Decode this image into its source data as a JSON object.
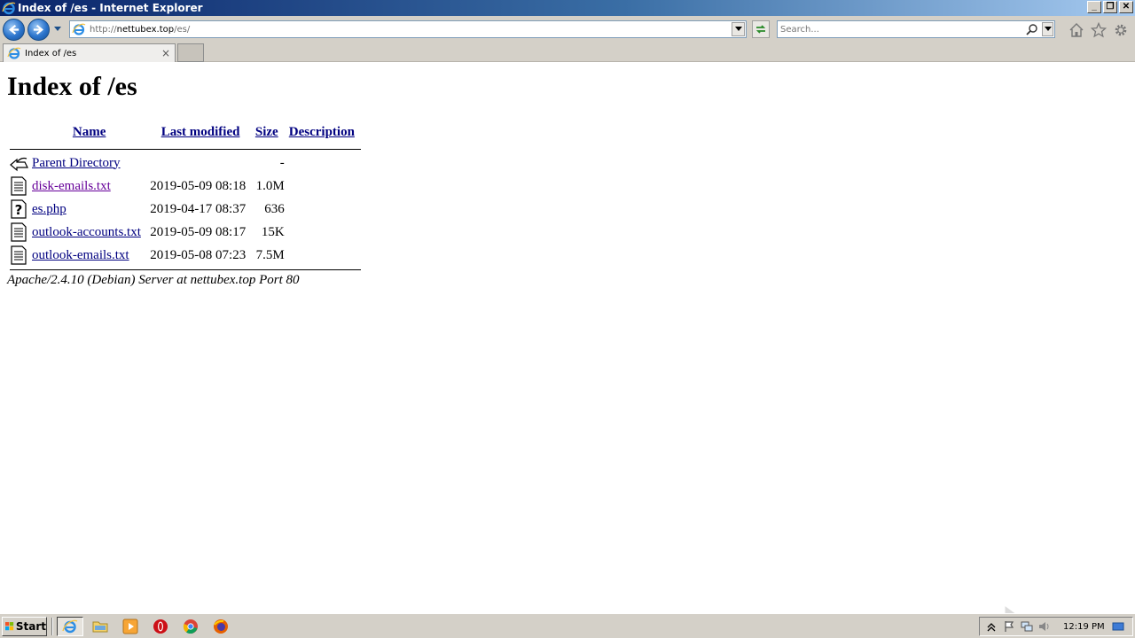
{
  "window": {
    "title": "Index of /es - Internet Explorer",
    "minimize_label": "_",
    "restore_label": "❐",
    "close_label": "✕"
  },
  "navbar": {
    "url_prefix": "http://",
    "url_host": "nettubex.top",
    "url_path": "/es/",
    "search_placeholder": "Search..."
  },
  "tabs": [
    {
      "label": "Index of /es",
      "close": "×"
    }
  ],
  "page": {
    "title": "Index of /es",
    "columns": {
      "name": "Name",
      "last_modified": "Last modified",
      "size": "Size",
      "description": "Description"
    },
    "rows": [
      {
        "icon": "back-arrow-icon",
        "name": "Parent Directory",
        "modified": "",
        "size": "-",
        "description": "",
        "visited": false
      },
      {
        "icon": "text-file-icon",
        "name": "disk-emails.txt",
        "modified": "2019-05-09 08:18",
        "size": "1.0M",
        "description": "",
        "visited": true
      },
      {
        "icon": "unknown-file-icon",
        "name": "es.php",
        "modified": "2019-04-17 08:37",
        "size": "636",
        "description": "",
        "visited": false
      },
      {
        "icon": "text-file-icon",
        "name": "outlook-accounts.txt",
        "modified": "2019-05-09 08:17",
        "size": "15K",
        "description": "",
        "visited": false
      },
      {
        "icon": "text-file-icon",
        "name": "outlook-emails.txt",
        "modified": "2019-05-08 07:23",
        "size": "7.5M",
        "description": "",
        "visited": false
      }
    ],
    "footer": "Apache/2.4.10 (Debian) Server at nettubex.top Port 80"
  },
  "taskbar": {
    "start_label": "Start",
    "clock": "12:19 PM"
  },
  "colors": {
    "link": "#000080",
    "visited_link": "#660099",
    "chrome": "#d4d0c8"
  }
}
